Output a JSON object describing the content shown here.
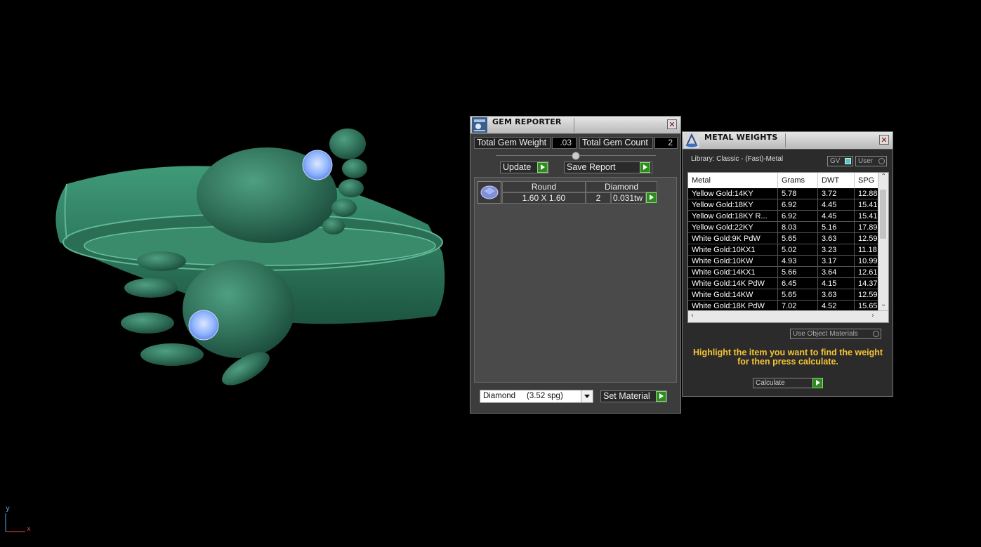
{
  "gem_reporter": {
    "title": "GEM REPORTER",
    "close": "✕",
    "total_weight_label": "Total Gem Weight",
    "total_weight_value": ".03",
    "total_count_label": "Total Gem Count",
    "total_count_value": "2",
    "update_label": "Update",
    "save_report_label": "Save Report",
    "gems": [
      {
        "shape": "Round",
        "material": "Diamond",
        "size": "1.60 X 1.60",
        "count": "2",
        "weight": "0.031tw"
      }
    ],
    "material_select": "Diamond     (3.52 spg)",
    "set_material_label": "Set Material"
  },
  "metal_weights": {
    "title": "METAL WEIGHTS",
    "close": "✕",
    "library": "Library: Classic - (Fast)-Metal",
    "toggle_gv": "GV",
    "toggle_user": "User",
    "columns": [
      "Metal",
      "Grams",
      "DWT",
      "SPG"
    ],
    "rows": [
      [
        "Yellow Gold:14KY",
        "5.78",
        "3.72",
        "12.88"
      ],
      [
        "Yellow Gold:18KY",
        "6.92",
        "4.45",
        "15.41"
      ],
      [
        "Yellow Gold:18KY R...",
        "6.92",
        "4.45",
        "15.41"
      ],
      [
        "Yellow Gold:22KY",
        "8.03",
        "5.16",
        "17.89"
      ],
      [
        "White Gold:9K PdW",
        "5.65",
        "3.63",
        "12.59"
      ],
      [
        "White Gold:10KX1",
        "5.02",
        "3.23",
        "11.18"
      ],
      [
        "White Gold:10KW",
        "4.93",
        "3.17",
        "10.99"
      ],
      [
        "White Gold:14KX1",
        "5.66",
        "3.64",
        "12.61"
      ],
      [
        "White Gold:14K PdW",
        "6.45",
        "4.15",
        "14.37"
      ],
      [
        "White Gold:14KW",
        "5.65",
        "3.63",
        "12.59"
      ],
      [
        "White Gold:18K PdW",
        "7.02",
        "4.52",
        "15.65"
      ]
    ],
    "use_object_materials": "Use Object Materials",
    "hint": "Highlight the item you want to find the weight for then press calculate.",
    "calculate_label": "Calculate"
  },
  "axes": {
    "y": "y",
    "x": "x"
  },
  "colors": {
    "model": "#2f7a5f",
    "gem": "#8fb4ff",
    "go_button": "#2f8a1f",
    "hint": "#f6c335"
  }
}
